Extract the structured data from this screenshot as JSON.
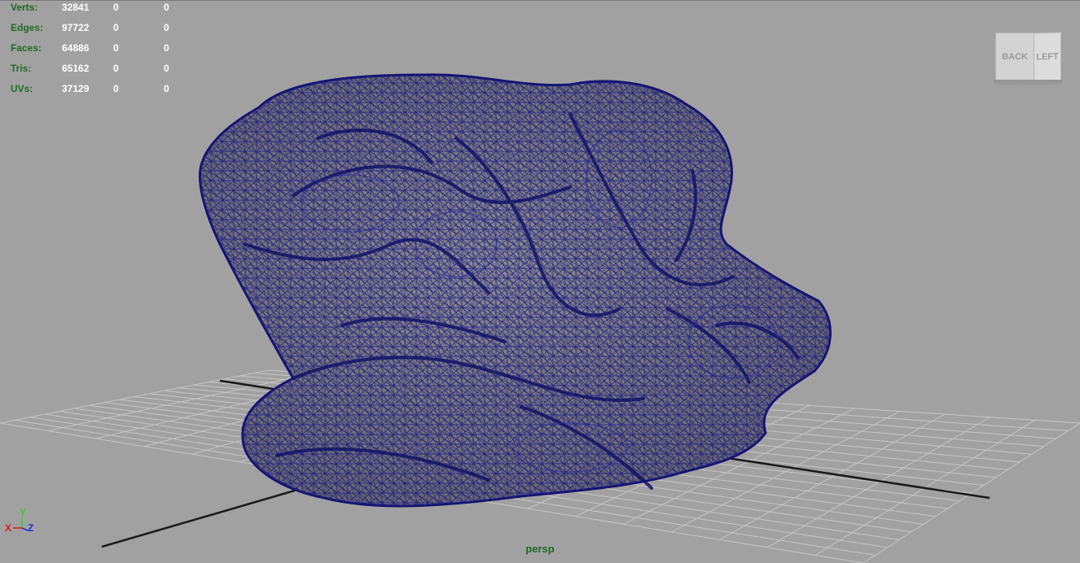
{
  "hud": {
    "rows": [
      {
        "label": "Verts:",
        "values": [
          "32841",
          "0",
          "0"
        ]
      },
      {
        "label": "Edges:",
        "values": [
          "97722",
          "0",
          "0"
        ]
      },
      {
        "label": "Faces:",
        "values": [
          "64886",
          "0",
          "0"
        ]
      },
      {
        "label": "Tris:",
        "values": [
          "65162",
          "0",
          "0"
        ]
      },
      {
        "label": "UVs:",
        "values": [
          "37129",
          "0",
          "0"
        ]
      }
    ]
  },
  "viewcube": {
    "back": "BACK",
    "left": "LEFT"
  },
  "axis": {
    "x": "X",
    "y": "Y",
    "z": "Z"
  },
  "camera": {
    "name": "persp"
  },
  "colors": {
    "viewport_bg": "#a1a1a1",
    "wireframe": "#1a1a8c",
    "mesh_fill": "#7e7e80",
    "grid": "#c6c6c6",
    "hud_label": "#1f6a25",
    "hud_value": "#ffffff"
  }
}
